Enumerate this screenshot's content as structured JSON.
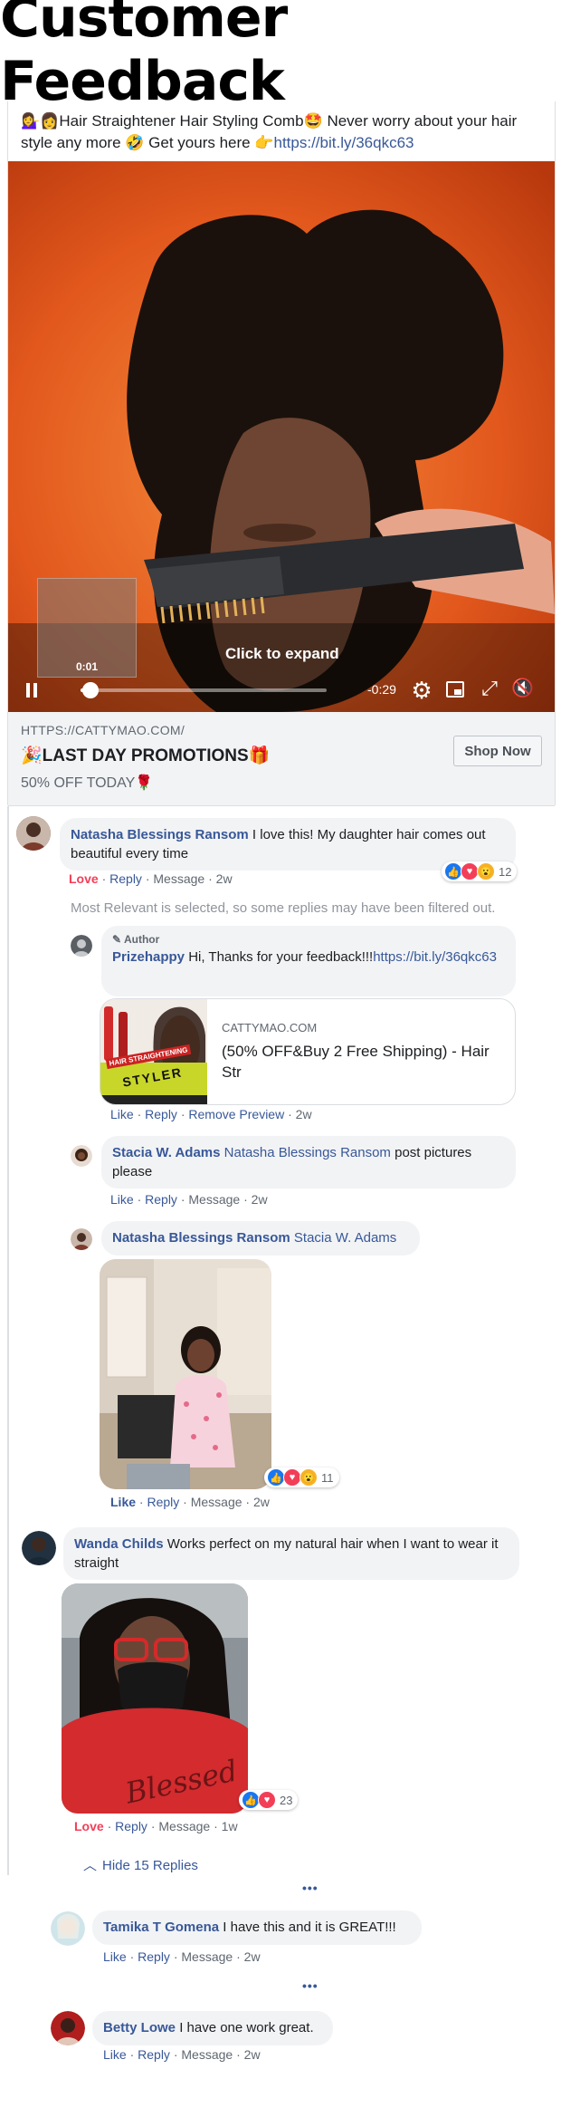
{
  "page": {
    "title": "Customer Feedback"
  },
  "post": {
    "text_prefix": "💁‍♀️👩Hair Straightener Hair Styling Comb🤩 Never worry about your hair style any more 🤣 Get yours here 👉",
    "link": "https://bit.ly/36qkc63",
    "video": {
      "expand_label": "Click to expand",
      "thumb_time": "0:01",
      "remaining_time": "-0:29",
      "progress": 0.04
    },
    "link_preview": {
      "domain": "HTTPS://CATTYMAO.COM/",
      "headline": "🎉LAST DAY PROMOTIONS🎁",
      "subline": "50% OFF TODAY🌹",
      "cta": "Shop Now"
    }
  },
  "comments": {
    "c1": {
      "name": "Natasha Blessings Ransom",
      "text": "I love this! My daughter hair comes out beautiful every time",
      "love": "Love",
      "reply": "Reply",
      "message": "Message",
      "time": "2w",
      "reaction_count": "12"
    },
    "filter_note": "Most Relevant is selected, so some replies may have been filtered out.",
    "r1": {
      "badge": "Author",
      "name": "Prizehappy",
      "text": "Hi, Thanks for your feedback!!!",
      "link": "https://bit.ly/36qkc63",
      "preview_domain": "CATTYMAO.COM",
      "preview_title": "(50% OFF&Buy 2 Free Shipping) - Hair Str",
      "thumb_text": "HAIR STRAIGHTENING",
      "thumb_text2": "STYLER",
      "like": "Like",
      "reply": "Reply",
      "remove": "Remove Preview",
      "time": "2w"
    },
    "r2": {
      "name": "Stacia W. Adams",
      "mention": "Natasha Blessings Ransom",
      "text": "post pictures please",
      "like": "Like",
      "reply": "Reply",
      "message": "Message",
      "time": "2w"
    },
    "r3": {
      "name": "Natasha Blessings Ransom",
      "mention": "Stacia W. Adams",
      "reaction_count": "11",
      "like": "Like",
      "reply": "Reply",
      "message": "Message",
      "time": "2w"
    },
    "c2": {
      "name": "Wanda Childs",
      "text": "Works perfect on my natural hair when I want to wear it straight",
      "shirt_text": "Blessed",
      "reaction_count": "23",
      "love": "Love",
      "reply": "Reply",
      "message": "Message",
      "time": "1w"
    },
    "hide_replies": "Hide 15 Replies",
    "more": "•••",
    "c3": {
      "name": "Tamika T Gomena",
      "text": "I have this and it is GREAT!!!",
      "like": "Like",
      "reply": "Reply",
      "message": "Message",
      "time": "2w"
    },
    "c4": {
      "name": "Betty Lowe",
      "text": "I have one work great.",
      "like": "Like",
      "reply": "Reply",
      "message": "Message",
      "time": "2w"
    }
  },
  "colors": {
    "link": "#385898",
    "love": "#f33e58",
    "like": "#1877f2",
    "bubble": "#f2f3f5"
  }
}
